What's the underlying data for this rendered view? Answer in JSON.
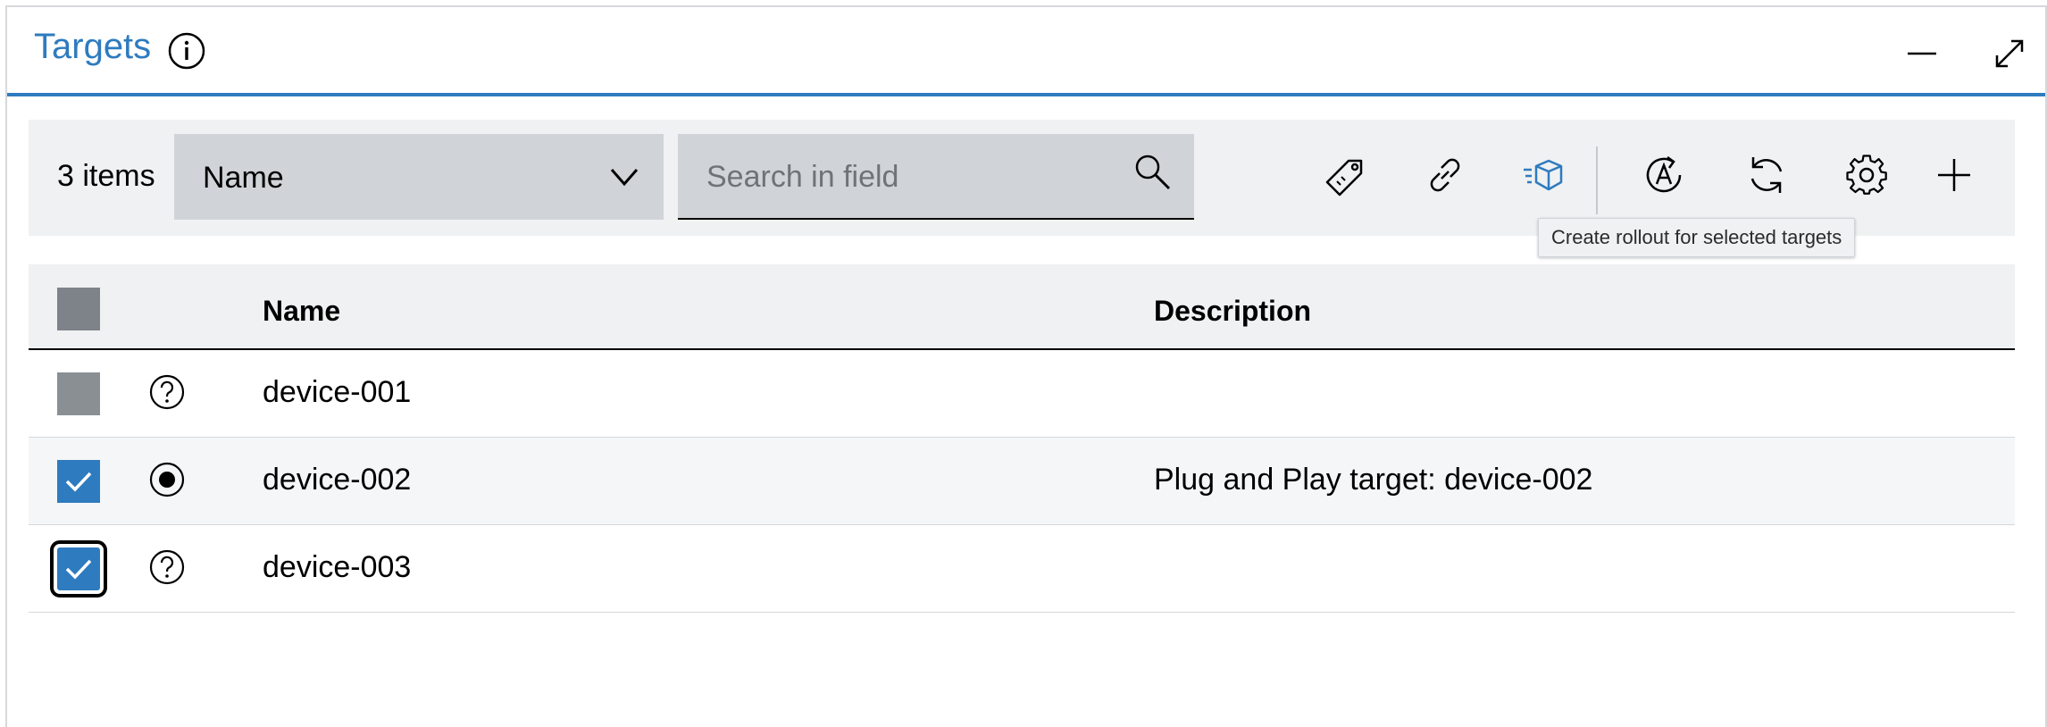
{
  "header": {
    "title": "Targets",
    "icons": [
      "info-icon",
      "minimize-icon",
      "maximize-icon"
    ]
  },
  "toolbar": {
    "items_count": "3 items",
    "field_select": {
      "selected": "Name"
    },
    "search": {
      "value": "",
      "placeholder": "Search in field"
    },
    "icons": [
      "tag-icon",
      "link-icon",
      "distribution-box-icon",
      "auto-assign-icon",
      "refresh-icon",
      "settings-icon",
      "add-icon"
    ],
    "tooltip": "Create rollout for selected targets"
  },
  "table": {
    "columns": [
      "Name",
      "Description"
    ],
    "rows": [
      {
        "name": "device-001",
        "description": "",
        "status": "unknown",
        "selected": false
      },
      {
        "name": "device-002",
        "description": "Plug and Play target: device-002",
        "status": "registered",
        "selected": true
      },
      {
        "name": "device-003",
        "description": "",
        "status": "unknown",
        "selected": true
      }
    ]
  },
  "colors": {
    "accent": "#2e7bbf",
    "toolbar_bg": "#eff1f2",
    "input_bg": "#d0d4d8",
    "checkbox_gray": "#8a8f94"
  }
}
